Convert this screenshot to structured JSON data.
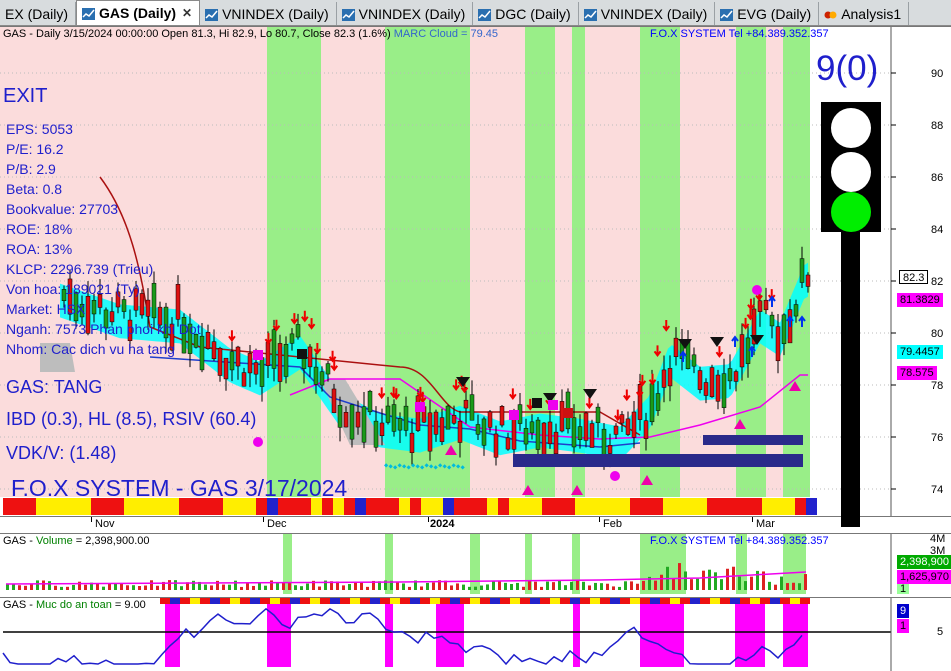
{
  "tabs": [
    {
      "label": "EX (Daily)",
      "active": false
    },
    {
      "label": "GAS (Daily)",
      "active": true
    },
    {
      "label": "VNINDEX (Daily)",
      "active": false
    },
    {
      "label": "VNINDEX (Daily)",
      "active": false
    },
    {
      "label": "DGC (Daily)",
      "active": false
    },
    {
      "label": "VNINDEX (Daily)",
      "active": false
    },
    {
      "label": "EVG (Daily)",
      "active": false
    },
    {
      "label": "Analysis1",
      "active": false
    }
  ],
  "main_pane": {
    "header": "GAS - Daily 3/15/2024 00:00:00 Open 81.3, Hi 82.9, Lo 80.7, Close 82.3 (1.6%)",
    "cloud": "MARC Cloud = 79.45",
    "fox_contact": "F.O.X SYSTEM Tel +84.389.352.357",
    "exit_label": "EXIT",
    "fundamentals": [
      "EPS: 5053",
      "P/E: 16.2",
      "P/B: 2.9",
      "Beta: 0.8",
      "Bookvalue: 27703",
      "ROE: 18%",
      "ROA: 13%",
      "KLCP: 2296.739 (Trieu)",
      "Von hoa: 189021 (Ty)",
      "Market: HSX",
      "Nganh: 7573 Phan phoi khi Dot",
      "Nhom: Cac dich vu ha tang"
    ],
    "signal_trend": "GAS: TANG",
    "signal_ibd": "IBD (0.3), HL (8.5), RSIV (60.4)",
    "signal_vdk": "VDK/V:  (1.48)",
    "big_title": "F.O.X SYSTEM - GAS 3/17/2024",
    "score_label": "9(0)",
    "traffic_light": {
      "top": "white",
      "middle": "white",
      "bottom": "green"
    },
    "price_axis": [
      "90",
      "88",
      "86",
      "84",
      "82",
      "80",
      "78",
      "76",
      "74"
    ],
    "price_tags": [
      {
        "text": "82.3",
        "bg": "#ffffff",
        "fg": "#000000"
      },
      {
        "text": "81.3829",
        "bg": "#ff00ff",
        "fg": "#000000"
      },
      {
        "text": "79.4457",
        "bg": "#00ffff",
        "fg": "#000000"
      },
      {
        "text": "78.575",
        "bg": "#ff00ff",
        "fg": "#000000"
      }
    ]
  },
  "date_axis": [
    {
      "label": "Nov",
      "bold": false
    },
    {
      "label": "Dec",
      "bold": false
    },
    {
      "label": "2024",
      "bold": true
    },
    {
      "label": "Feb",
      "bold": false
    },
    {
      "label": "Mar",
      "bold": false
    }
  ],
  "volume_pane": {
    "title_prefix": "GAS - ",
    "title_series": "Volume",
    "title_value": " = 2,398,900.00",
    "fox_contact": "F.O.X SYSTEM Tel +84.389.352.357",
    "axis": [
      "4M",
      "3M"
    ],
    "tags": [
      {
        "text": "2,398,900",
        "bg": "#00aa00",
        "fg": "#ffffff"
      },
      {
        "text": "1,625,970",
        "bg": "#ff00ff",
        "fg": "#000000"
      },
      {
        "text": "1",
        "bg": "#99ff99",
        "fg": "#000000"
      }
    ]
  },
  "safety_pane": {
    "title_prefix": "GAS - ",
    "title_series": "Muc do an toan",
    "title_value": " = 9.00",
    "axis": [
      "5"
    ],
    "tags": [
      {
        "text": "9",
        "bg": "#0000cc",
        "fg": "#ffffff"
      },
      {
        "text": "1",
        "bg": "#ff00ff",
        "fg": "#000000"
      }
    ]
  },
  "colors": {
    "pink_zone": "#fbdcdc",
    "green_zone": "#99ee88",
    "candle_up": "#1a9a1a",
    "candle_down": "#dd1111",
    "text_blue": "#1f1fcc",
    "cloud_cyan": "#00ffff"
  }
}
